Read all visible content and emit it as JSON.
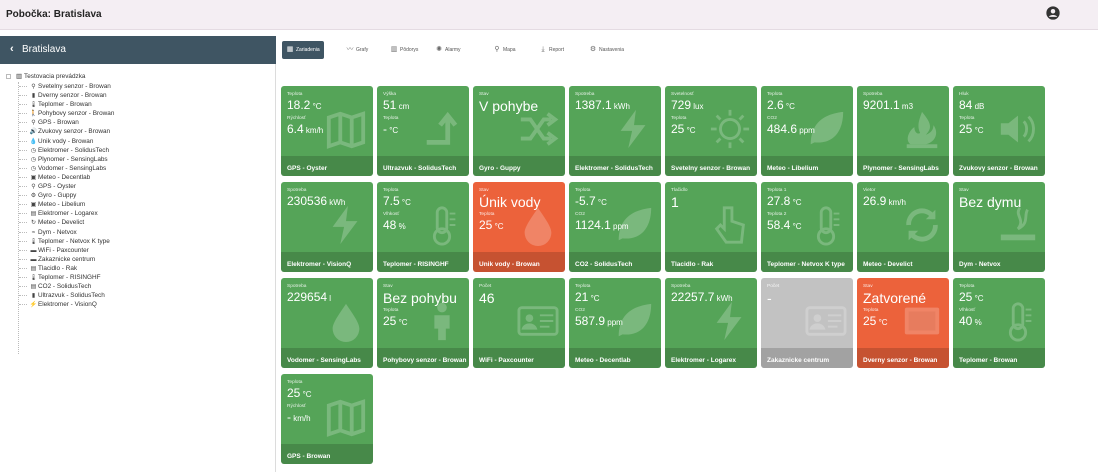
{
  "header": {
    "title": "Pobočka: Bratislava",
    "user_text": ""
  },
  "sidebar": {
    "title": "Bratislava",
    "root": "Testovacia prevádzka",
    "items": [
      {
        "icon": "bulb-icon",
        "glyph": "⚲",
        "label": "Svetelny senzor - Browan"
      },
      {
        "icon": "door-icon",
        "glyph": "▮",
        "label": "Dverny senzor - Browan"
      },
      {
        "icon": "thermometer-icon",
        "glyph": "🌡",
        "label": "Teplomer - Browan"
      },
      {
        "icon": "person-walking-icon",
        "glyph": "🚶",
        "label": "Pohybovy senzor - Browan"
      },
      {
        "icon": "location-icon",
        "glyph": "⚲",
        "label": "GPS - Browan"
      },
      {
        "icon": "speaker-icon",
        "glyph": "🔊",
        "label": "Zvukovy senzor - Browan"
      },
      {
        "icon": "drop-icon",
        "glyph": "💧",
        "label": "Unik vody - Browan"
      },
      {
        "icon": "gauge-icon",
        "glyph": "◷",
        "label": "Elektromer - SolidusTech"
      },
      {
        "icon": "gauge-icon",
        "glyph": "◷",
        "label": "Plynomer - SensingLabs"
      },
      {
        "icon": "gauge-icon",
        "glyph": "◷",
        "label": "Vodomer - SensingLabs"
      },
      {
        "icon": "weather-icon",
        "glyph": "▣",
        "label": "Meteo - Decentlab"
      },
      {
        "icon": "location-icon",
        "glyph": "⚲",
        "label": "GPS - Oyster"
      },
      {
        "icon": "gear-icon",
        "glyph": "⚙",
        "label": "Gyro - Guppy"
      },
      {
        "icon": "weather-icon",
        "glyph": "▣",
        "label": "Meteo - Libelium"
      },
      {
        "icon": "meter-icon",
        "glyph": "▤",
        "label": "Elektromer - Logarex"
      },
      {
        "icon": "refresh-icon",
        "glyph": "↻",
        "label": "Meteo - Develict"
      },
      {
        "icon": "smoke-icon",
        "glyph": "≈",
        "label": "Dym - Netvox"
      },
      {
        "icon": "thermometer-icon",
        "glyph": "🌡",
        "label": "Teplomer - Netvox K type"
      },
      {
        "icon": "wifi-icon",
        "glyph": "▬",
        "label": "WiFi - Paxcounter"
      },
      {
        "icon": "people-icon",
        "glyph": "▬",
        "label": "Zakaznicke centrum"
      },
      {
        "icon": "button-icon",
        "glyph": "▤",
        "label": "Tlacidlo - Rak"
      },
      {
        "icon": "thermometer-icon",
        "glyph": "🌡",
        "label": "Teplomer - RISINGHF"
      },
      {
        "icon": "co2-icon",
        "glyph": "▤",
        "label": "CO2 - SolidusTech"
      },
      {
        "icon": "ultrasound-icon",
        "glyph": "▮",
        "label": "Ultrazvuk - SolidusTech"
      },
      {
        "icon": "bolt-icon",
        "glyph": "⚡",
        "label": "Elektromer - VisionQ"
      }
    ]
  },
  "tabs": [
    {
      "label": "Zariadenia",
      "icon": "grid-icon",
      "glyph": "▦",
      "active": true
    },
    {
      "label": "Grafy",
      "icon": "chart-icon",
      "glyph": "〰",
      "active": false
    },
    {
      "label": "Pôdorys",
      "icon": "floorplan-icon",
      "glyph": "▥",
      "active": false
    },
    {
      "label": "Alarmy",
      "icon": "alarm-icon",
      "glyph": "✺",
      "active": false
    },
    {
      "label": "Mapa",
      "icon": "map-pin-icon",
      "glyph": "⚲",
      "active": false
    },
    {
      "label": "Report",
      "icon": "download-icon",
      "glyph": "⤓",
      "active": false
    },
    {
      "label": "Nastavenia",
      "icon": "gear-icon",
      "glyph": "⚙",
      "active": false
    }
  ],
  "tiles": [
    {
      "name": "GPS - Oyster",
      "state": "normal",
      "icon": "map-icon",
      "lines": [
        {
          "label": "Teplota",
          "value": "18.2",
          "unit": "°C"
        },
        {
          "label": "Rýchlosť",
          "value": "6.4",
          "unit": "km/h"
        }
      ]
    },
    {
      "name": "Ultrazvuk - SolidusTech",
      "state": "normal",
      "icon": "arrow-up-icon",
      "lines": [
        {
          "label": "Výška",
          "value": "51",
          "unit": "cm"
        },
        {
          "label": "Teplota",
          "value": "-",
          "unit": "°C"
        }
      ]
    },
    {
      "name": "Gyro - Guppy",
      "state": "normal",
      "icon": "shuffle-icon",
      "lines": [
        {
          "label": "Stav",
          "value": "V pohybe",
          "unit": ""
        }
      ]
    },
    {
      "name": "Elektromer - SolidusTech",
      "state": "normal",
      "icon": "bolt-icon",
      "lines": [
        {
          "label": "Spotreba",
          "value": "1387.1",
          "unit": "kWh"
        }
      ]
    },
    {
      "name": "Svetelny senzor - Browan",
      "state": "normal",
      "icon": "sun-icon",
      "lines": [
        {
          "label": "Svetelnosť",
          "value": "729",
          "unit": "lux"
        },
        {
          "label": "Teplota",
          "value": "25",
          "unit": "°C"
        }
      ]
    },
    {
      "name": "Meteo - Libelium",
      "state": "normal",
      "icon": "leaf-icon",
      "lines": [
        {
          "label": "Teplota",
          "value": "2.6",
          "unit": "°C"
        },
        {
          "label": "CO2",
          "value": "484.6",
          "unit": "ppm"
        }
      ]
    },
    {
      "name": "Plynomer - SensingLabs",
      "state": "normal",
      "icon": "flame-icon",
      "lines": [
        {
          "label": "Spotreba",
          "value": "9201.1",
          "unit": "m3"
        }
      ]
    },
    {
      "name": "Zvukovy senzor - Browan",
      "state": "normal",
      "icon": "speaker-icon",
      "lines": [
        {
          "label": "Hluk",
          "value": "84",
          "unit": "dB"
        },
        {
          "label": "Teplota",
          "value": "25",
          "unit": "°C"
        }
      ]
    },
    {
      "name": "Elektromer - VisionQ",
      "state": "normal",
      "icon": "bolt-icon",
      "lines": [
        {
          "label": "Spotreba",
          "value": "230536",
          "unit": "kWh"
        }
      ]
    },
    {
      "name": "Teplomer - RISINGHF",
      "state": "normal",
      "icon": "thermometer-icon",
      "lines": [
        {
          "label": "Teplota",
          "value": "7.5",
          "unit": "°C"
        },
        {
          "label": "Vlhkosť",
          "value": "48",
          "unit": "%"
        }
      ]
    },
    {
      "name": "Unik vody - Browan",
      "state": "alert",
      "icon": "drop-icon",
      "lines": [
        {
          "label": "Stav",
          "value": "Únik vody",
          "unit": ""
        },
        {
          "label": "Teplota",
          "value": "25",
          "unit": "°C"
        }
      ]
    },
    {
      "name": "CO2 - SolidusTech",
      "state": "normal",
      "icon": "leaf-icon",
      "lines": [
        {
          "label": "Teplota",
          "value": "-5.7",
          "unit": "°C"
        },
        {
          "label": "CO2",
          "value": "1124.1",
          "unit": "ppm"
        }
      ]
    },
    {
      "name": "Tlacidlo - Rak",
      "state": "normal",
      "icon": "pointer-icon",
      "lines": [
        {
          "label": "Tlačidlo",
          "value": "1",
          "unit": ""
        }
      ]
    },
    {
      "name": "Teplomer - Netvox K type",
      "state": "normal",
      "icon": "thermometer-icon",
      "lines": [
        {
          "label": "Teplota 1",
          "value": "27.8",
          "unit": "°C"
        },
        {
          "label": "Teplota 2",
          "value": "58.4",
          "unit": "°C"
        }
      ]
    },
    {
      "name": "Meteo - Develict",
      "state": "normal",
      "icon": "refresh-icon",
      "lines": [
        {
          "label": "Vietor",
          "value": "26.9",
          "unit": "km/h"
        }
      ]
    },
    {
      "name": "Dym - Netvox",
      "state": "normal",
      "icon": "smoke-icon",
      "lines": [
        {
          "label": "Stav",
          "value": "Bez dymu",
          "unit": ""
        }
      ]
    },
    {
      "name": "Vodomer - SensingLabs",
      "state": "normal",
      "icon": "drop-icon",
      "lines": [
        {
          "label": "Spotreba",
          "value": "229654",
          "unit": "l"
        }
      ]
    },
    {
      "name": "Pohybovy senzor - Browan",
      "state": "normal",
      "icon": "person-icon",
      "lines": [
        {
          "label": "Stav",
          "value": "Bez pohybu",
          "unit": ""
        },
        {
          "label": "Teplota",
          "value": "25",
          "unit": "°C"
        }
      ]
    },
    {
      "name": "WiFi - Paxcounter",
      "state": "normal",
      "icon": "id-card-icon",
      "lines": [
        {
          "label": "Počet",
          "value": "46",
          "unit": ""
        }
      ]
    },
    {
      "name": "Meteo - Decentlab",
      "state": "normal",
      "icon": "leaf-icon",
      "lines": [
        {
          "label": "Teplota",
          "value": "21",
          "unit": "°C"
        },
        {
          "label": "CO2",
          "value": "587.9",
          "unit": "ppm"
        }
      ]
    },
    {
      "name": "Elektromer - Logarex",
      "state": "normal",
      "icon": "bolt-icon",
      "lines": [
        {
          "label": "Spotreba",
          "value": "22257.7",
          "unit": "kWh"
        }
      ]
    },
    {
      "name": "Zakaznicke centrum",
      "state": "off",
      "icon": "id-card-icon",
      "lines": [
        {
          "label": "Počet",
          "value": "-",
          "unit": ""
        }
      ]
    },
    {
      "name": "Dverny senzor - Browan",
      "state": "alert",
      "icon": "door-icon",
      "lines": [
        {
          "label": "Stav",
          "value": "Zatvorené",
          "unit": ""
        },
        {
          "label": "Teplota",
          "value": "25",
          "unit": "°C"
        }
      ]
    },
    {
      "name": "Teplomer - Browan",
      "state": "normal",
      "icon": "thermometer-icon",
      "lines": [
        {
          "label": "Teplota",
          "value": "25",
          "unit": "°C"
        },
        {
          "label": "Vlhkosť",
          "value": "40",
          "unit": "%"
        }
      ]
    },
    {
      "name": "GPS - Browan",
      "state": "normal",
      "icon": "map-icon",
      "lines": [
        {
          "label": "Teplota",
          "value": "25",
          "unit": "°C"
        },
        {
          "label": "Rýchlosť",
          "value": "-",
          "unit": "km/h"
        }
      ]
    }
  ],
  "colors": {
    "normal": "#55a458",
    "alert": "#ec623b",
    "off": "#c2c2c2",
    "header": "#3f5563"
  }
}
